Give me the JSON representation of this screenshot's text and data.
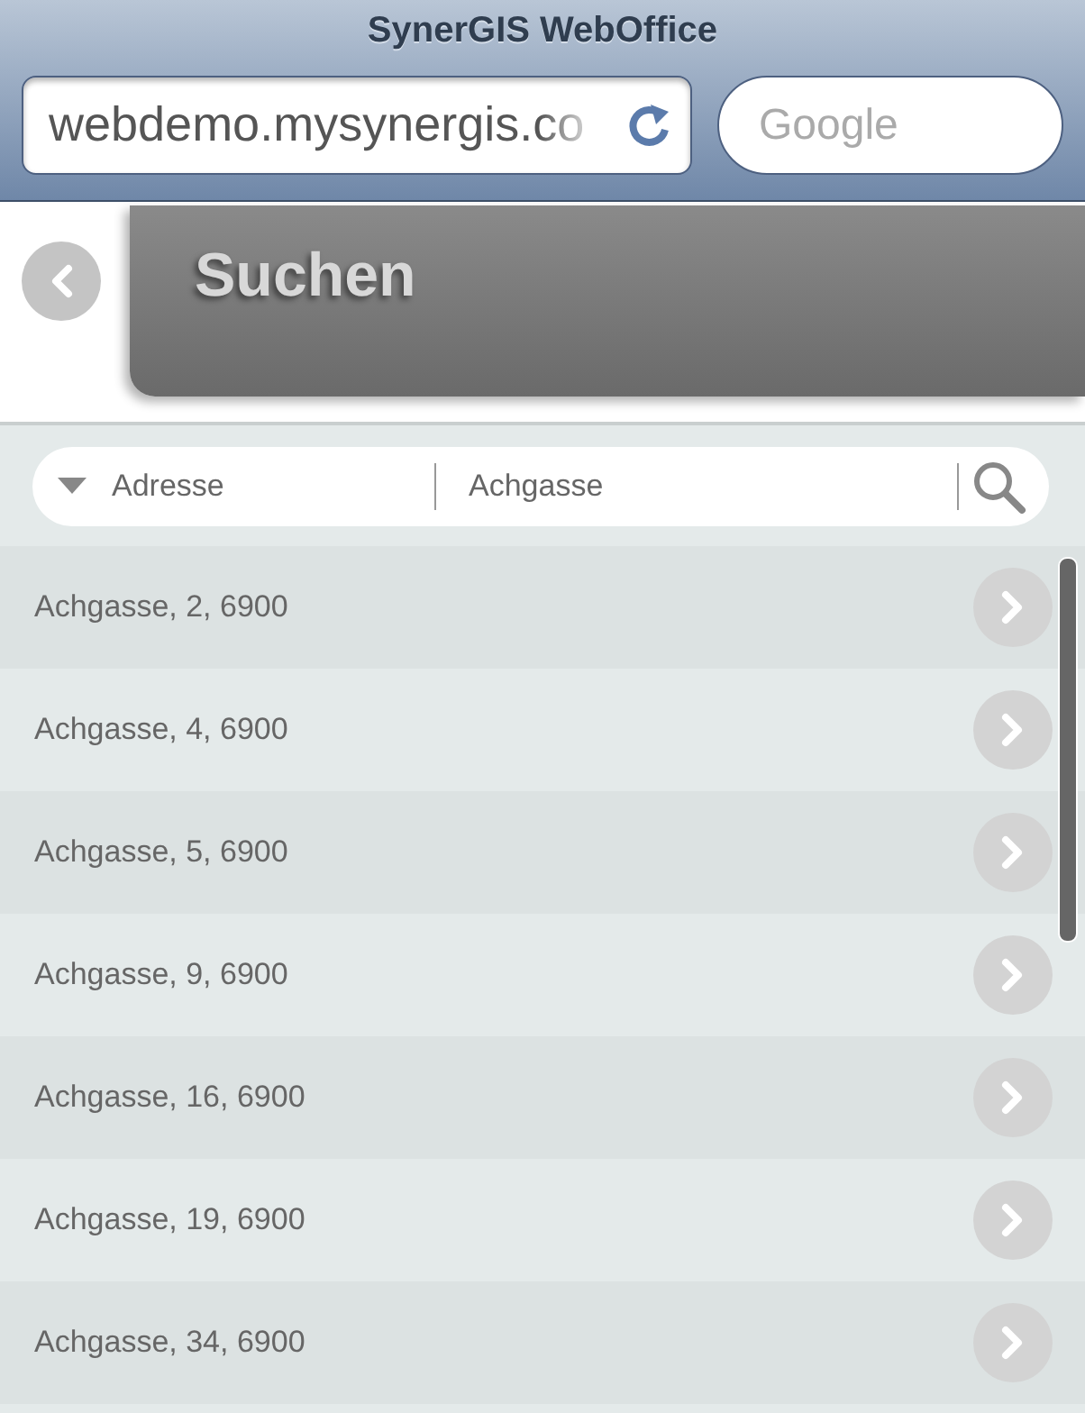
{
  "browser": {
    "title": "SynerGIS WebOffice",
    "url": "webdemo.mysynergis.co",
    "search_placeholder": "Google"
  },
  "page": {
    "title": "Suchen"
  },
  "search": {
    "category": "Adresse",
    "value": "Achgasse"
  },
  "results": [
    {
      "label": "Achgasse, 2, 6900"
    },
    {
      "label": "Achgasse, 4, 6900"
    },
    {
      "label": "Achgasse, 5, 6900"
    },
    {
      "label": "Achgasse, 9, 6900"
    },
    {
      "label": "Achgasse, 16, 6900"
    },
    {
      "label": "Achgasse, 19, 6900"
    },
    {
      "label": "Achgasse, 34, 6900"
    }
  ]
}
